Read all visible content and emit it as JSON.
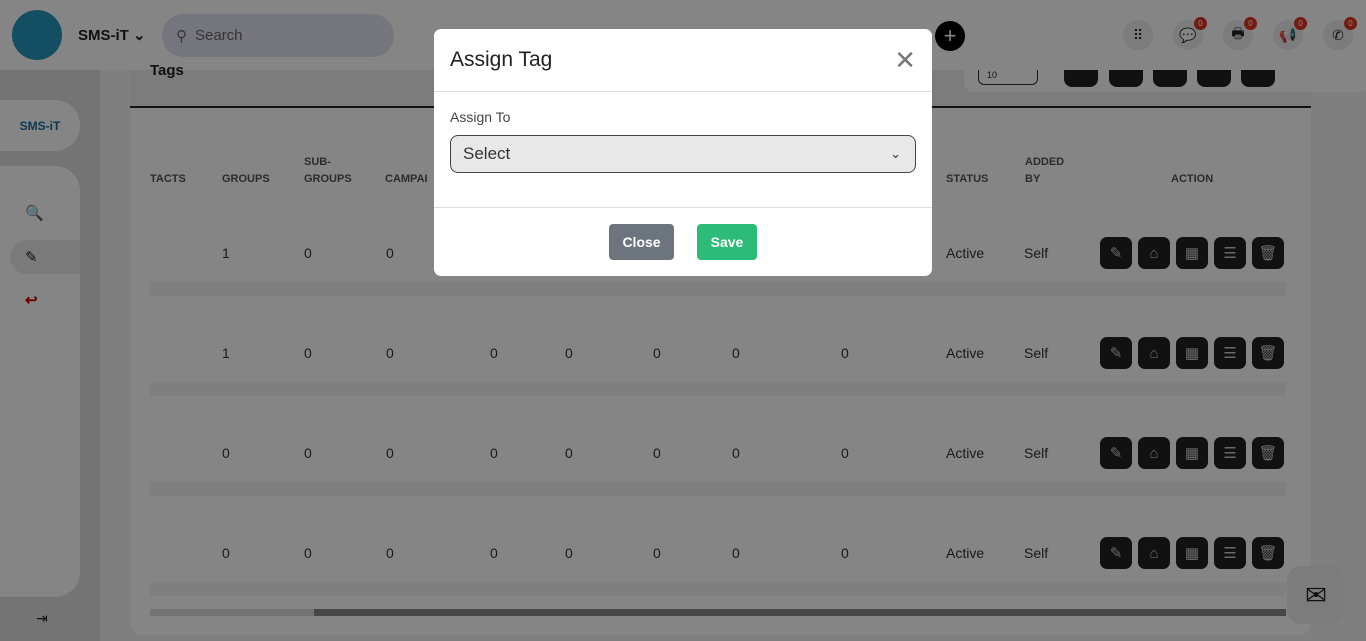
{
  "header": {
    "brand": "SMS-iT",
    "search_placeholder": "Search",
    "badges": {
      "messages": "0",
      "fax": "0",
      "campaigns": "0",
      "calls": "0"
    }
  },
  "sidebar": {
    "logo_text": "SMS-iT"
  },
  "page": {
    "title": "Tags",
    "page_size": "10"
  },
  "table": {
    "headers": {
      "contacts": "TACTS",
      "groups": "GROUPS",
      "subgroups": "SUB-GROUPS",
      "campaigns": "CAMPAI",
      "status": "STATUS",
      "added_by": "ADDED BY",
      "action": "ACTION"
    },
    "rows": [
      {
        "c": [
          "1",
          "0",
          "0",
          "",
          "",
          "",
          "",
          ""
        ],
        "status": "Active",
        "added_by": "Self"
      },
      {
        "c": [
          "1",
          "0",
          "0",
          "0",
          "0",
          "0",
          "0",
          "0"
        ],
        "status": "Active",
        "added_by": "Self"
      },
      {
        "c": [
          "0",
          "0",
          "0",
          "0",
          "0",
          "0",
          "0",
          "0"
        ],
        "status": "Active",
        "added_by": "Self"
      },
      {
        "c": [
          "0",
          "0",
          "0",
          "0",
          "0",
          "0",
          "0",
          "0"
        ],
        "status": "Active",
        "added_by": "Self"
      }
    ]
  },
  "modal": {
    "title": "Assign Tag",
    "field_label": "Assign To",
    "select_value": "Select",
    "close_label": "Close",
    "save_label": "Save"
  },
  "colors": {
    "accent": "#2dbb7a",
    "close_btn": "#6c757d",
    "badge": "#dd3322"
  }
}
